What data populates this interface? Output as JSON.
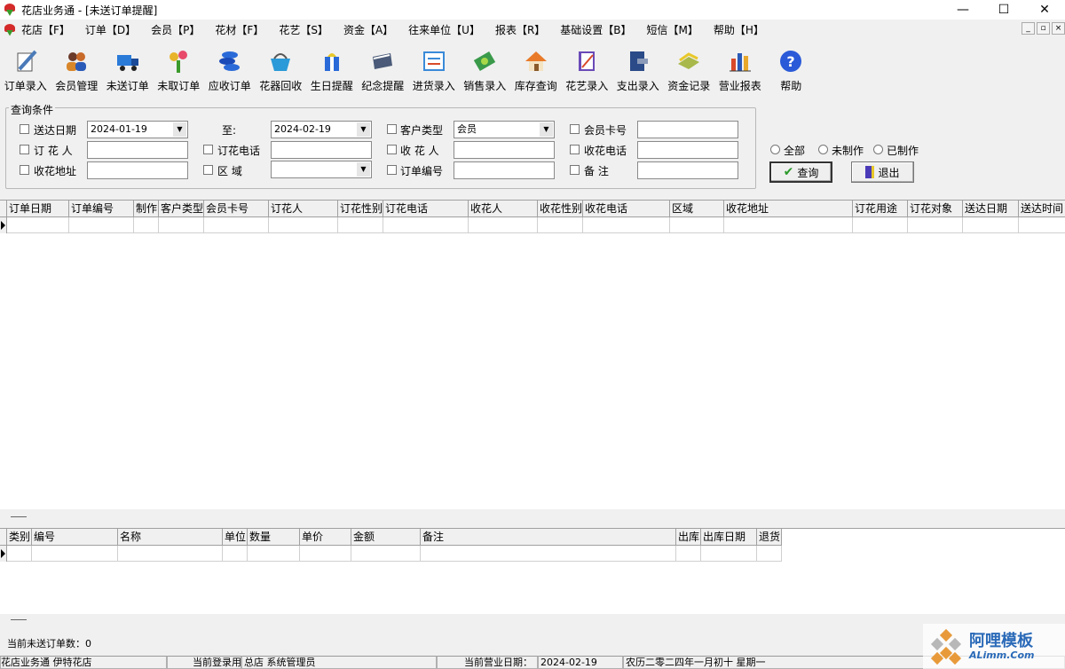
{
  "window": {
    "title": "花店业务通 - [未送订单提醒]",
    "min": "—",
    "max": "☐",
    "close": "✕"
  },
  "menu": [
    "花店【F】",
    "订单【D】",
    "会员【P】",
    "花材【F】",
    "花艺【S】",
    "资金【A】",
    "往来单位【U】",
    "报表【R】",
    "基础设置【B】",
    "短信【M】",
    "帮助【H】"
  ],
  "mdi": {
    "min": "_",
    "restore": "▫",
    "close": "×"
  },
  "toolbar": [
    {
      "label": "订单录入",
      "icon": "pen-document-icon",
      "color": "#4a7ab8"
    },
    {
      "label": "会员管理",
      "icon": "members-icon",
      "color": "#d8862a"
    },
    {
      "label": "未送订单",
      "icon": "truck-icon",
      "color": "#2a7ad8"
    },
    {
      "label": "未取订单",
      "icon": "flowers-icon",
      "color": "#e8b42a"
    },
    {
      "label": "应收订单",
      "icon": "coins-icon",
      "color": "#2a6ad8"
    },
    {
      "label": "花器回收",
      "icon": "basket-icon",
      "color": "#2a9ad8"
    },
    {
      "label": "生日提醒",
      "icon": "gift-icon",
      "color": "#2a6ad8"
    },
    {
      "label": "纪念提醒",
      "icon": "card-icon",
      "color": "#4a5a78"
    },
    {
      "label": "进货录入",
      "icon": "invoice-icon",
      "color": "#3a8ad8"
    },
    {
      "label": "销售录入",
      "icon": "money-icon",
      "color": "#3a9a4a"
    },
    {
      "label": "库存查询",
      "icon": "house-icon",
      "color": "#e87a2a"
    },
    {
      "label": "花艺录入",
      "icon": "notebook-icon",
      "color": "#6a4ab8"
    },
    {
      "label": "支出录入",
      "icon": "wallet-icon",
      "color": "#2a4a88"
    },
    {
      "label": "资金记录",
      "icon": "cash-icon",
      "color": "#a8b84a"
    },
    {
      "label": "营业报表",
      "icon": "bar-chart-icon",
      "color": "#d84a2a"
    },
    {
      "label": "帮助",
      "icon": "help-icon",
      "color": "#2a5ad8"
    }
  ],
  "query": {
    "legend": "查询条件",
    "send_date_label": "送达日期",
    "date_from": "2024-01-19",
    "to_label": "至:",
    "date_to": "2024-02-19",
    "customer_type_label": "客户类型",
    "customer_type_value": "会员",
    "member_card_label": "会员卡号",
    "orderer_label": "订 花 人",
    "order_phone_label": "订花电话",
    "receiver_label": "收 花 人",
    "receive_phone_label": "收花电话",
    "address_label": "收花地址",
    "area_label": "区    域",
    "order_no_label": "订单编号",
    "remark_label": "备    注"
  },
  "filter": {
    "all": "全部",
    "unmade": "未制作",
    "made": "已制作"
  },
  "buttons": {
    "query": "查询",
    "exit": "退出"
  },
  "grid1_columns": [
    "订单日期",
    "订单编号",
    "制作",
    "客户类型",
    "会员卡号",
    "订花人",
    "订花性别",
    "订花电话",
    "收花人",
    "收花性别",
    "收花电话",
    "区域",
    "收花地址",
    "订花用途",
    "订花对象",
    "送达日期",
    "送达时间"
  ],
  "grid2_columns": [
    "类别",
    "编号",
    "名称",
    "单位",
    "数量",
    "单价",
    "金额",
    "备注",
    "出库",
    "出库日期",
    "退货"
  ],
  "status": {
    "unsent_count": "当前未送订单数：0",
    "app": "花店业务通 伊特花店",
    "user_label": "当前登录用户：",
    "user_value": "总店  系统管理员",
    "date_label": "当前营业日期：",
    "date_value": "2024-02-19",
    "lunar": "农历二零二四年一月初十  星期一"
  },
  "watermark": {
    "line1": "阿哩模板",
    "line2": "ALimm.Com"
  }
}
